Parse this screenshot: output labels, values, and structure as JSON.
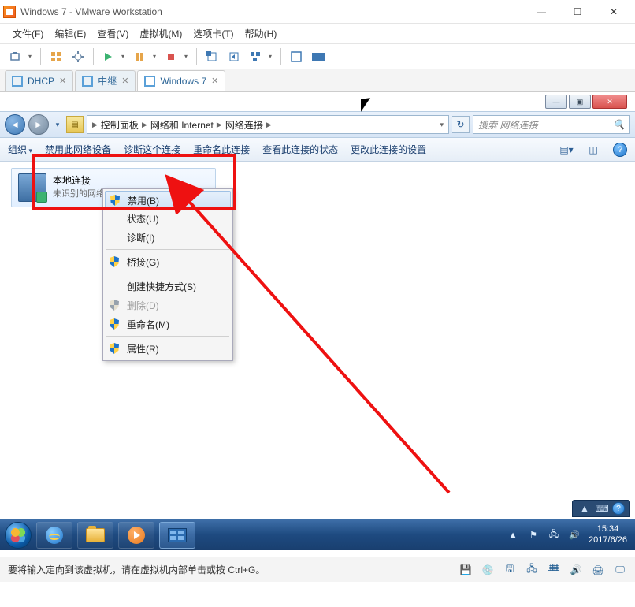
{
  "vmware": {
    "title": "Windows 7 - VMware Workstation",
    "menu": {
      "file": "文件(F)",
      "edit": "编辑(E)",
      "view": "查看(V)",
      "vm": "虚拟机(M)",
      "tabs": "选项卡(T)",
      "help": "帮助(H)"
    },
    "tabs": [
      {
        "label": "DHCP"
      },
      {
        "label": "中继"
      },
      {
        "label": "Windows 7"
      }
    ],
    "status": "要将输入定向到该虚拟机，请在虚拟机内部单击或按 Ctrl+G。"
  },
  "explorer": {
    "breadcrumb": {
      "a": "控制面板",
      "b": "网络和 Internet",
      "c": "网络连接"
    },
    "search_placeholder": "搜索 网络连接",
    "toolbar": {
      "org": "组织",
      "disable": "禁用此网络设备",
      "diag": "诊断这个连接",
      "rename": "重命名此连接",
      "status": "查看此连接的状态",
      "settings": "更改此连接的设置"
    },
    "item": {
      "title": "本地连接",
      "subtitle": "未识别的网络"
    },
    "ctx": {
      "disable": "禁用(B)",
      "status": "状态(U)",
      "diag": "诊断(I)",
      "bridge": "桥接(G)",
      "shortcut": "创建快捷方式(S)",
      "delete": "删除(D)",
      "rename": "重命名(M)",
      "props": "属性(R)"
    }
  },
  "taskbar": {
    "time": "15:34",
    "date": "2017/6/26"
  }
}
